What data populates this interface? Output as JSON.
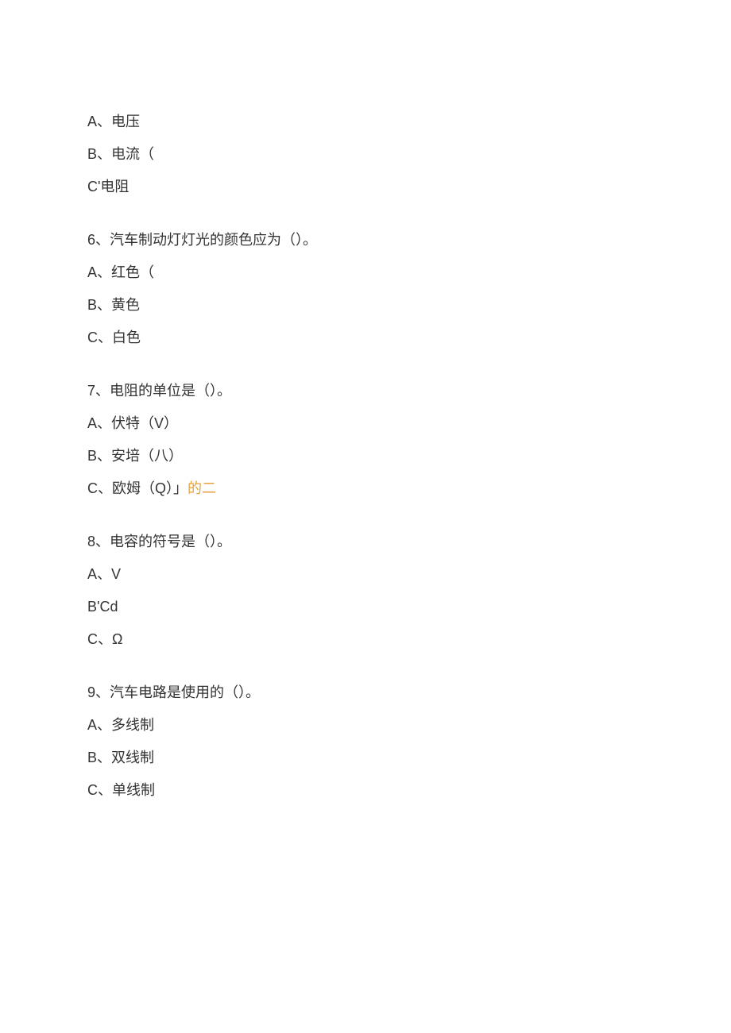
{
  "q5": {
    "optA": "A、电压",
    "optB": "B、电流（",
    "optC": "C'电阻"
  },
  "q6": {
    "stem": "6、汽车制动灯灯光的颜色应为（）。",
    "optA": "A、红色（",
    "optB": "B、黄色",
    "optC": "C、白色"
  },
  "q7": {
    "stem": "7、电阻的单位是（）。",
    "optA": "A、伏特（V）",
    "optB": "B、安培（八）",
    "optC_prefix": "C、欧姆（Q）」",
    "optC_highlight": "的二"
  },
  "q8": {
    "stem": "8、电容的符号是（）。",
    "optA": "A、V",
    "optB": "B'Cd",
    "optC": "C、Ω"
  },
  "q9": {
    "stem": "9、汽车电路是使用的（）。",
    "optA": "A、多线制",
    "optB": "B、双线制",
    "optC": "C、单线制"
  }
}
